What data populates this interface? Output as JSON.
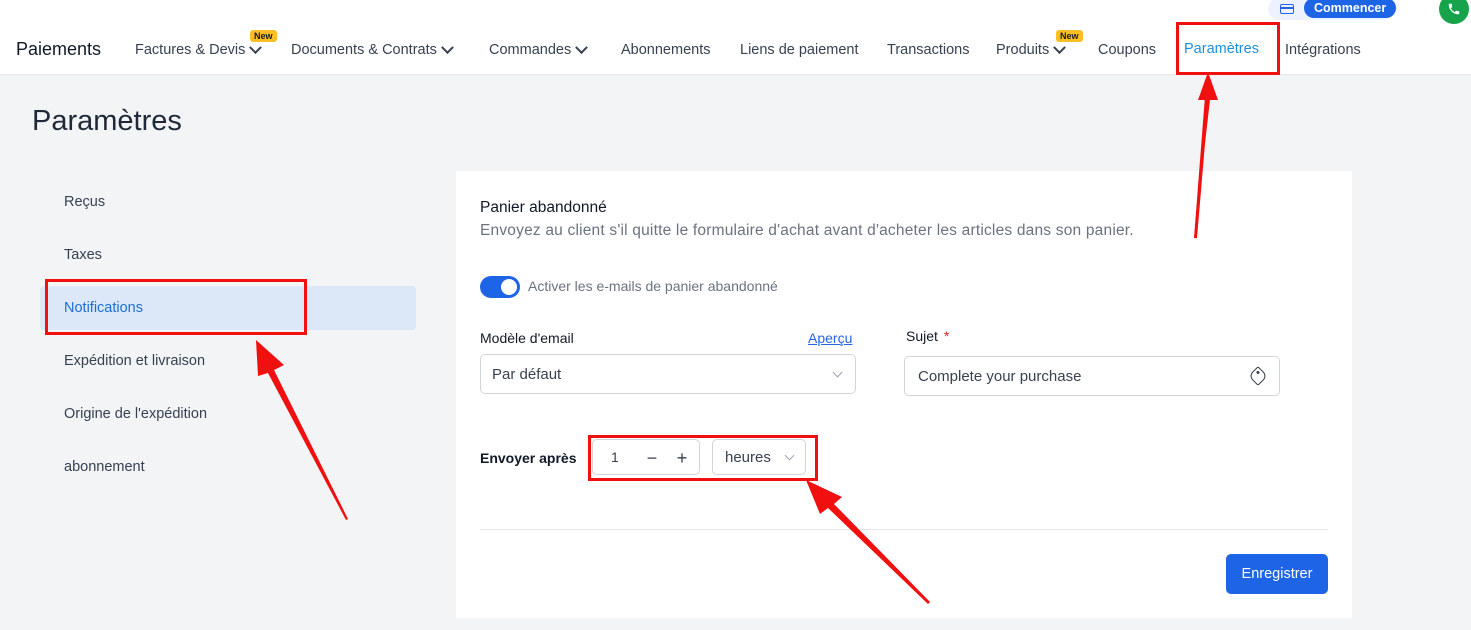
{
  "header": {
    "brand": "Paiements",
    "nav": [
      {
        "label": "Factures & Devis",
        "has_dropdown": true,
        "badge": "New"
      },
      {
        "label": "Documents & Contrats",
        "has_dropdown": true
      },
      {
        "label": "Commandes",
        "has_dropdown": true
      },
      {
        "label": "Abonnements"
      },
      {
        "label": "Liens de paiement"
      },
      {
        "label": "Transactions"
      },
      {
        "label": "Produits",
        "has_dropdown": true,
        "badge": "New"
      },
      {
        "label": "Coupons"
      },
      {
        "label": "Paramètres",
        "active": true
      },
      {
        "label": "Intégrations"
      }
    ],
    "commencer_label": "Commencer"
  },
  "page": {
    "title": "Paramètres"
  },
  "sidebar": {
    "items": [
      {
        "label": "Reçus"
      },
      {
        "label": "Taxes"
      },
      {
        "label": "Notifications",
        "active": true
      },
      {
        "label": "Expédition et livraison"
      },
      {
        "label": "Origine de l'expédition"
      },
      {
        "label": "abonnement"
      }
    ]
  },
  "form": {
    "title": "Panier abandonné",
    "subtitle": "Envoyez au client s'il quitte le formulaire d'achat avant d'acheter les articles dans son panier.",
    "toggle_label": "Activer les e-mails de panier abandonné",
    "toggle_on": true,
    "template_label": "Modèle d'email",
    "preview_link": "Aperçu",
    "template_value": "Par défaut",
    "subject_label": "Sujet",
    "required_mark": "*",
    "subject_value": "Complete your purchase",
    "send_after_label": "Envoyer après",
    "send_after_value": "1",
    "minus": "−",
    "plus": "+",
    "unit_value": "heures",
    "save_label": "Enregistrer"
  },
  "colors": {
    "accent": "#1e64e6",
    "active_nav": "#1d8fe1",
    "annotation": "#f01010",
    "badge": "#fbbf24"
  }
}
